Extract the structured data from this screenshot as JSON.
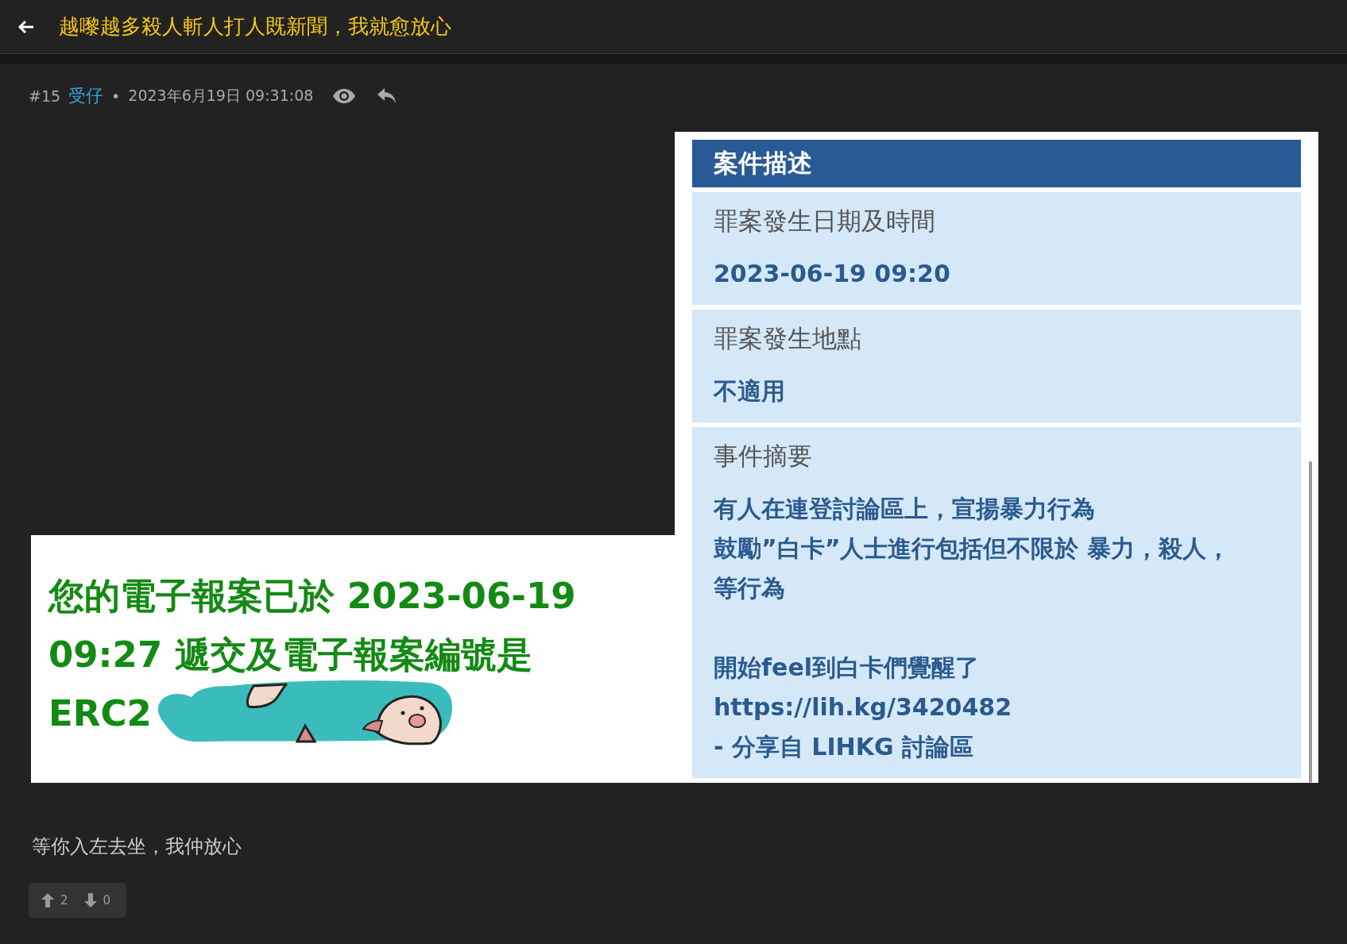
{
  "header": {
    "title": "越嚟越多殺人斬人打人既新聞，我就愈放心"
  },
  "post": {
    "number": "#15",
    "author": "受仔",
    "separator": "•",
    "timestamp": "2023年6月19日 09:31:08",
    "confirmation_image": {
      "lines": [
        "您的電子報案已於 2023-06-19",
        "09:27 遞交及電子報案編號是",
        "ERC2"
      ]
    },
    "case_form_image": {
      "heading": "案件描述",
      "fields": [
        {
          "label": "罪案發生日期及時間",
          "value_lines": [
            "2023-06-19 09:20"
          ]
        },
        {
          "label": "罪案發生地點",
          "value_lines": [
            "不適用"
          ]
        },
        {
          "label": "事件摘要",
          "value_lines": [
            "有人在連登討論區上，宣揚暴力行為",
            "鼓勵”白卡”人士進行包括但不限於 暴力，殺人，",
            "等行為",
            "開始feel到白卡們覺醒了",
            "https://lih.kg/3420482",
            "- 分享自 LIHKG 討論區"
          ]
        }
      ]
    },
    "comment": "等你入左去坐，我仲放心",
    "votes": {
      "up": "2",
      "down": "0"
    }
  }
}
